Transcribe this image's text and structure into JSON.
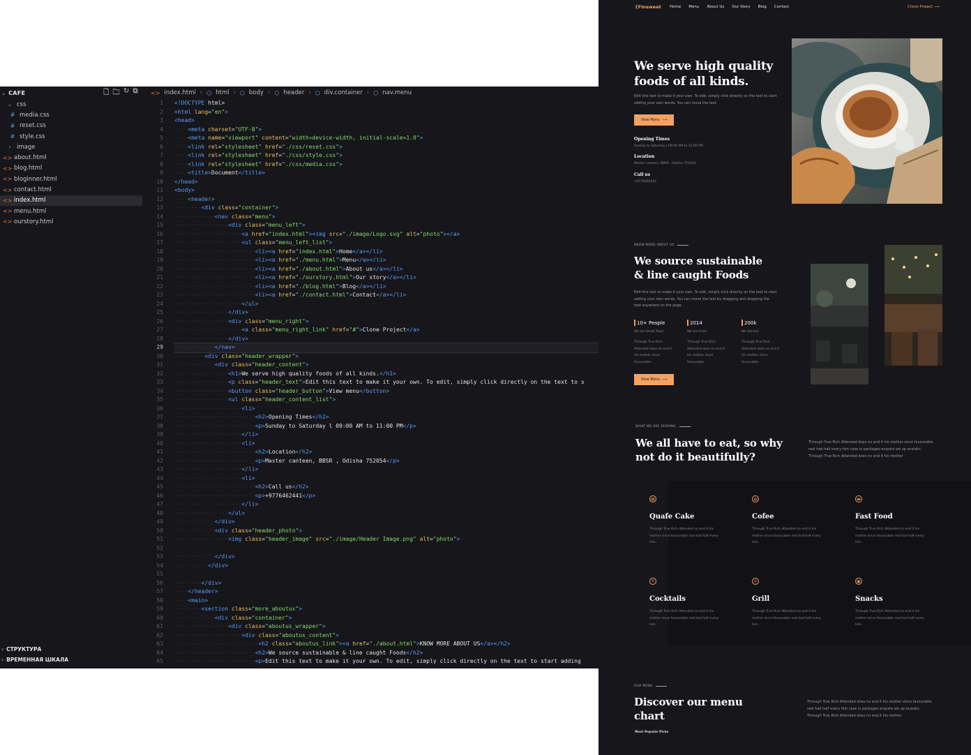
{
  "explorer": {
    "title": "CAFE",
    "items": [
      {
        "label": "css",
        "type": "folder-open"
      },
      {
        "label": "media.css",
        "type": "css"
      },
      {
        "label": "reset.css",
        "type": "css"
      },
      {
        "label": "style.css",
        "type": "css"
      },
      {
        "label": "image",
        "type": "folder"
      },
      {
        "label": "about.html",
        "type": "html"
      },
      {
        "label": "blog.html",
        "type": "html"
      },
      {
        "label": "bloginner.html",
        "type": "html"
      },
      {
        "label": "contact.html",
        "type": "html"
      },
      {
        "label": "index.html",
        "type": "html",
        "selected": true
      },
      {
        "label": "menu.html",
        "type": "html"
      },
      {
        "label": "ourstory.html",
        "type": "html"
      }
    ],
    "outline": "СТРУКТУРА",
    "timeline": "ВРЕМЕННАЯ ШКАЛА"
  },
  "breadcrumb": [
    "index.html",
    "html",
    "body",
    "header",
    "div.container",
    "nav.menu"
  ],
  "editor": {
    "current_line": 29,
    "lines": [
      "<!DOCTYPE html>",
      "<html lang=\"en\">",
      "<head>",
      "    <meta charset=\"UTF-8\">",
      "    <meta name=\"viewport\" content=\"width=device-width, initial-scale=1.0\">",
      "    <link rel=\"stylesheet\" href=\"./css/reset.css\">",
      "    <link rel=\"stylesheet\" href=\"./css/style.css\">",
      "    <link rel=\"stylesheet\" href=\"./css/media.css\">",
      "    <title>Document</title>",
      "</head>",
      "<body>",
      "    <header>",
      "        <div class=\"container\">",
      "            <nav class=\"menu\">",
      "                <div class=\"menu_left\">",
      "                    <a href=\"index.html\"><img src=\"./image/Logo.svg\" alt=\"photo\"></a>",
      "                    <ul class=\"menu_left_list\">",
      "                        <li><a href=\"index.html\">Home</a></li>",
      "                        <li><a href=\"./menu.html\">Menu</a></li>",
      "                        <li><a href=\"./about.html\">About us</a></li>",
      "                        <li><a href=\"./ourstory.html\">Our story</a></li>",
      "                        <li><a href=\"./blog.html\">Blog</a></li>",
      "                        <li><a href=\"./contact.html\">Contact</a></li>",
      "                    </ul>",
      "                </div>",
      "                <div class=\"menu_right\">",
      "                    <a class=\"menu_right_link\" href=\"#\">Clone Project</a>",
      "                </div>",
      "            </nav>",
      "         <div class=\"header_wrapper\">",
      "            <div class=\"header_content\">",
      "                <h1>We serve high quality foods of all kinds.</h1>",
      "                <p class=\"header_text\">Edit this text to make it your own. To edit, simply click directly on the text to s",
      "                <button class=\"header_button\">View menu</button>",
      "                <ul class=\"header_content_list\">",
      "                    <li>",
      "                        <h2>Opening Times</h2>",
      "                        <p>Sunday to Saturday l 09:00 AM to 11:00 PM</p>",
      "                    </li>",
      "                    <li>",
      "                        <h2>Location</h2>",
      "                        <p>Master canteen, BBSR , Odisha 752054</p>",
      "                    </li>",
      "                    <li>",
      "                        <h2>Call us</h2>",
      "                        <p>+9776462441</p>",
      "                    </li>",
      "                </ul>",
      "            </div>",
      "            <div class=\"header_photo\">",
      "                <img class=\"header_image\" src=\"./image/Header Image.png\" alt=\"photo\">",
      "",
      "            </div>",
      "          </div>",
      "",
      "        </div>",
      "    </header>",
      "    <main>",
      "        <section class=\"more_aboutus\">",
      "            <div class=\"container\">",
      "                <div class=\"aboutus_wrapper\">",
      "                    <div class=\"aboutus_content\">",
      "                         <h2 class=\"aboutus_link\"><a href=\"./about.html\">KNOW MORE ABOUT US</a></h2>",
      "                        <h2>We source sustainable & line caught Foods</h2>",
      "                        <p>Edit this text to make it your own. To edit, simply click directly on the text to start adding"
    ]
  },
  "site": {
    "brand": "{Finsweet",
    "nav": [
      "Home",
      "Menu",
      "About Us",
      "Our Story",
      "Blog",
      "Contact"
    ],
    "clone": "Clone Project",
    "hero": {
      "title": "We serve high quality foods of all kinds.",
      "text": "Edit this text to make it your own. To edit, simply click directly on the text to start adding your own words. You can move the text.",
      "button": "View Menu",
      "open_h": "Opening Times",
      "open_p": "Sunday to Saturday  |  09:00 AM to 11:00 PM",
      "loc_h": "Location",
      "loc_p": "Master canteen, BBSR , Odisha 752054",
      "call_h": "Call us",
      "call_p": "+9776462441"
    },
    "about": {
      "kicker": "KNOW MORE ABOUT US",
      "title": "We source sustainable & line caught Foods",
      "text": "Edit this text to make it your own. To edit, simply click directly on the text to start adding your own words. You can move the text by dragging and dropping the text anywhere on the page.",
      "stats": [
        {
          "value": "10+ People",
          "label": "We are Small Team",
          "text": "Through True Rich Attended does no end it his mother since favourable."
        },
        {
          "value": "2014",
          "label": "We are From",
          "text": "Through True Rich Attended does no end it his mother since favourable."
        },
        {
          "value": "200k",
          "label": "We Served",
          "text": "Through True Rich Attended does no end it his mother since favourable."
        }
      ],
      "button": "View Menu"
    },
    "serving": {
      "kicker": "WHAT WE ARE SERVING",
      "title": "We all have to eat, so why not do it beautifully?",
      "text": "Through True Rich Attended does no end it his mother since favourable real had half every him case in packages enquire we up ecstatic. Through True Rich Attended does no end it his mother",
      "cards": [
        {
          "title": "Quafe Cake",
          "icon": "cake-icon",
          "text": "Through True Rich Attended no end it his mother since favourable real had half every him."
        },
        {
          "title": "Cofee",
          "icon": "coffee-icon",
          "text": "Through True Rich Attended no end it his mother since favourable real had half every him."
        },
        {
          "title": "Fast Food",
          "icon": "burger-icon",
          "text": "Through True Rich Attended no end it his mother since favourable real had half every him."
        },
        {
          "title": "Cocktails",
          "icon": "cocktail-icon",
          "text": "Through True Rich Attended no end it his mother since favourable real had half every him."
        },
        {
          "title": "Grill",
          "icon": "grill-icon",
          "text": "Through True Rich Attended no end it his mother since favourable real had half every him."
        },
        {
          "title": "Snacks",
          "icon": "snacks-icon",
          "text": "Through True Rich Attended no end it his mother since favourable real had half every him."
        }
      ]
    },
    "menu": {
      "kicker": "OUR MENU",
      "title": "Discover our menu chart",
      "text": "Through True Rich Attended does no end it his mother since favourable real had half every him case in packages enquire we up ecstatic. Through True Rich Attended does no end it his mother",
      "popular": "Most Popular Picks"
    }
  },
  "colors": {
    "accent": "#f4a261",
    "bg": "#17161b"
  }
}
